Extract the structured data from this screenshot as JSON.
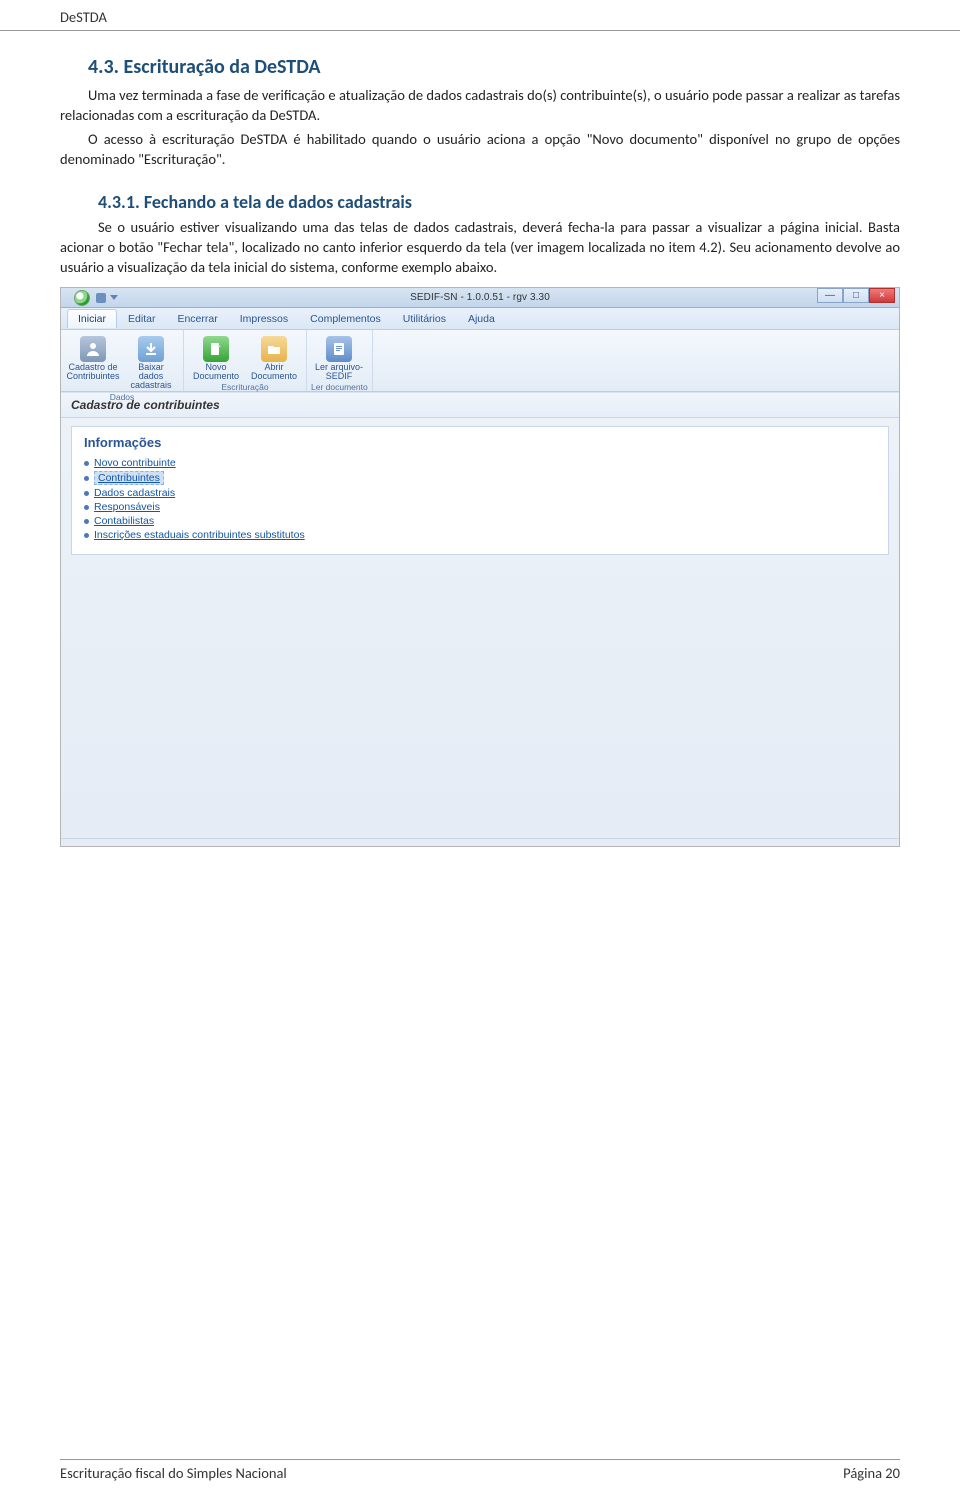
{
  "header": {
    "title": "DeSTDA"
  },
  "section": {
    "num": "4.3.",
    "title": "Escrituração da DeSTDA",
    "para1": "Uma vez terminada a fase de verificação e atualização de dados cadastrais do(s) contribuinte(s), o usuário pode passar a realizar as tarefas relacionadas com a escrituração da DeSTDA.",
    "para2": "O acesso à escrituração DeSTDA é habilitado quando o usuário aciona a opção \"Novo documento\" disponível no grupo de opções denominado \"Escrituração\"."
  },
  "subsection": {
    "num": "4.3.1.",
    "title": "Fechando a tela de dados cadastrais",
    "para": "Se o usuário estiver visualizando uma das telas de dados cadastrais, deverá fecha-la para passar a visualizar a página inicial. Basta acionar o botão \"Fechar tela\", localizado no canto inferior esquerdo da tela (ver imagem localizada no item 4.2). Seu acionamento devolve ao usuário a visualização da tela inicial do sistema, conforme exemplo abaixo."
  },
  "app": {
    "window_title": "SEDIF-SN - 1.0.0.51 - rgv 3.30",
    "win_min": "—",
    "win_max": "□",
    "win_close": "×",
    "menus": [
      "Iniciar",
      "Editar",
      "Encerrar",
      "Impressos",
      "Complementos",
      "Utilitários",
      "Ajuda"
    ],
    "ribbon": {
      "groups": [
        {
          "label": "Dados",
          "buttons": [
            {
              "label": "Cadastro de Contribuintes",
              "icon": "user-card-icon",
              "color": "#7f97b5"
            },
            {
              "label": "Baixar dados cadastrais",
              "icon": "download-icon",
              "color": "#6fa0d4"
            }
          ]
        },
        {
          "label": "Escrituração",
          "buttons": [
            {
              "label": "Novo Documento",
              "icon": "new-doc-icon",
              "color": "#36a336"
            },
            {
              "label": "Abrir Documento",
              "icon": "open-doc-icon",
              "color": "#e8b34a"
            }
          ]
        },
        {
          "label": "Ler documento",
          "buttons": [
            {
              "label": "Ler arquivo-SEDIF",
              "icon": "read-file-icon",
              "color": "#5f8dc9"
            }
          ]
        }
      ]
    },
    "tab_caption": "Cadastro de contribuintes",
    "info_title": "Informações",
    "info_links": [
      "Novo contribuinte",
      "Contribuintes",
      "Dados cadastrais",
      "Responsáveis",
      "Contabilistas",
      "Inscrições estaduais contribuintes substitutos"
    ],
    "selected_index": 1
  },
  "footer": {
    "left": "Escrituração fiscal do Simples Nacional",
    "right": "Página 20"
  }
}
